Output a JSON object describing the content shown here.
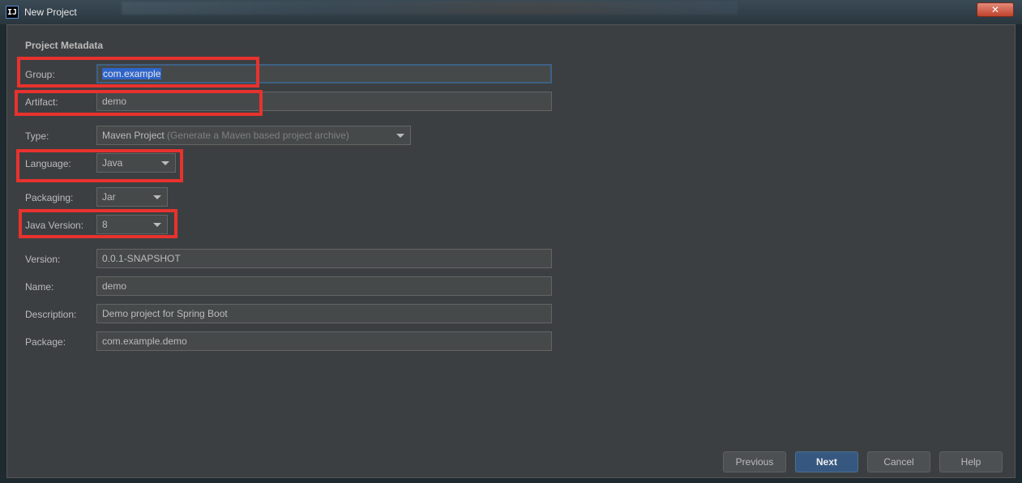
{
  "window": {
    "title": "New Project",
    "icon_glyph": "IJ",
    "close_glyph": "✕"
  },
  "section_title": "Project Metadata",
  "fields": {
    "group": {
      "label": "Group:",
      "value": "com.example"
    },
    "artifact": {
      "label": "Artifact:",
      "value": "demo"
    },
    "type": {
      "label": "Type:",
      "value": "Maven Project",
      "hint": "(Generate a Maven based project archive)"
    },
    "language": {
      "label": "Language:",
      "value": "Java"
    },
    "packaging": {
      "label": "Packaging:",
      "value": "Jar"
    },
    "java_version": {
      "label": "Java Version:",
      "value": "8"
    },
    "version": {
      "label": "Version:",
      "value": "0.0.1-SNAPSHOT"
    },
    "name": {
      "label": "Name:",
      "value": "demo"
    },
    "description": {
      "label": "Description:",
      "value": "Demo project for Spring Boot"
    },
    "package": {
      "label": "Package:",
      "value": "com.example.demo"
    }
  },
  "buttons": {
    "previous": "Previous",
    "next": "Next",
    "cancel": "Cancel",
    "help": "Help"
  },
  "colors": {
    "highlight": "#e8322e",
    "primary_button": "#365880",
    "panel": "#3c3f41",
    "selection": "#2f65ca"
  }
}
